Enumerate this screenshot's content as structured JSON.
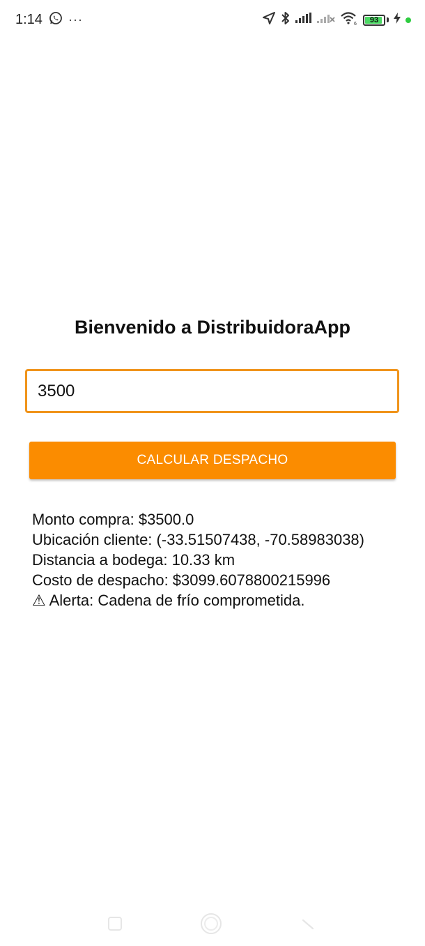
{
  "status_bar": {
    "time": "1:14",
    "more": "···",
    "battery_level": "93",
    "battery_fraction": 0.93,
    "icons": [
      "whatsapp-icon",
      "location-arrow-icon",
      "bluetooth-icon",
      "signal-icon",
      "signal-no-service-icon",
      "wifi-icon",
      "battery-icon",
      "charging-icon"
    ]
  },
  "main": {
    "title": "Bienvenido a DistribuidoraApp",
    "amount_value": "3500",
    "button_label": "CALCULAR DESPACHO",
    "results": {
      "monto": "Monto compra: $3500.0",
      "ubicacion": "Ubicación cliente: (-33.51507438, -70.58983038)",
      "distancia": "Distancia a bodega: 10.33 km",
      "costo": "Costo de despacho: $3099.6078800215996",
      "alerta": "⚠ Alerta: Cadena de frío comprometida."
    }
  },
  "colors": {
    "accent": "#fb8c00",
    "input_border": "#f0941b",
    "battery_green": "#4cd964"
  },
  "nav_bar": {
    "buttons": [
      "recent-apps",
      "home",
      "back"
    ]
  }
}
